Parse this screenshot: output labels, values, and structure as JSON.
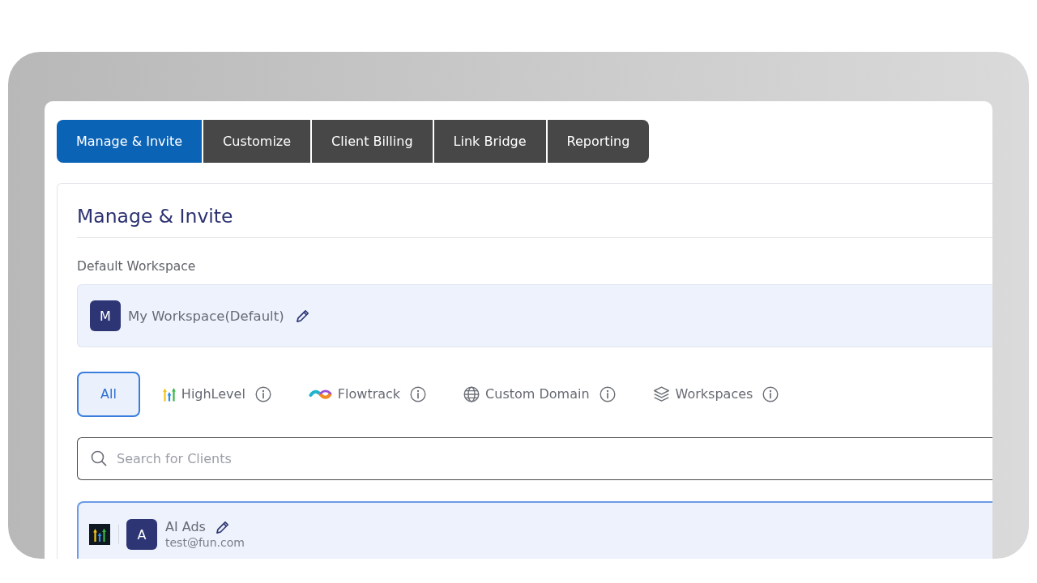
{
  "tabs": [
    {
      "label": "Manage & Invite",
      "selected": true
    },
    {
      "label": "Customize",
      "selected": false
    },
    {
      "label": "Client Billing",
      "selected": false
    },
    {
      "label": "Link Bridge",
      "selected": false
    },
    {
      "label": "Reporting",
      "selected": false
    }
  ],
  "section": {
    "title": "Manage & Invite"
  },
  "default_workspace": {
    "label": "Default Workspace",
    "avatar": "M",
    "name": "My Workspace(Default)"
  },
  "filters": [
    {
      "label": "All",
      "kind": "all",
      "selected": true,
      "info": false
    },
    {
      "label": "HighLevel",
      "kind": "highlevel",
      "selected": false,
      "info": true
    },
    {
      "label": "Flowtrack",
      "kind": "flowtrack",
      "selected": false,
      "info": true
    },
    {
      "label": "Custom Domain",
      "kind": "domain",
      "selected": false,
      "info": true
    },
    {
      "label": "Workspaces",
      "kind": "workspaces",
      "selected": false,
      "info": true
    }
  ],
  "search": {
    "placeholder": "Search for Clients"
  },
  "clients": [
    {
      "kind": "highlevel",
      "avatar": "A",
      "name": "AI Ads",
      "email": "test@fun.com",
      "selected": true
    }
  ]
}
